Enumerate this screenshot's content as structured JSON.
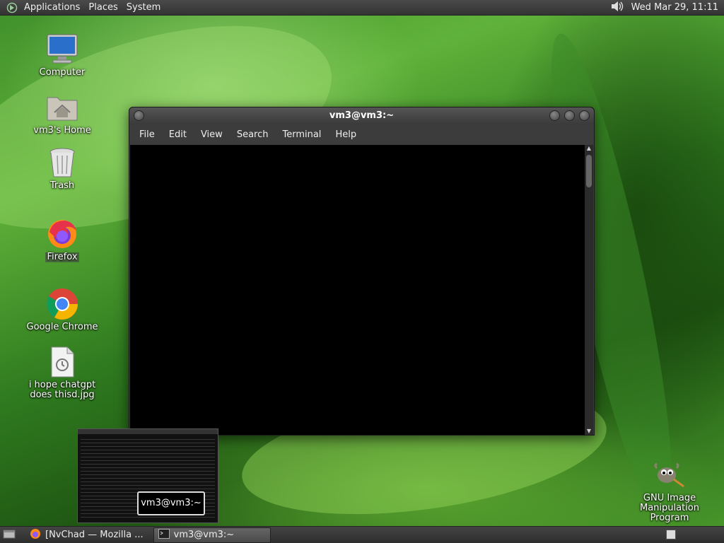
{
  "top_panel": {
    "menus": [
      "Applications",
      "Places",
      "System"
    ],
    "clock": "Wed Mar 29, 11:11"
  },
  "desktop": {
    "icons": [
      {
        "label": "Computer",
        "icon": "computer-icon"
      },
      {
        "label": "vm3's Home",
        "icon": "home-folder-icon"
      },
      {
        "label": "Trash",
        "icon": "trash-icon"
      },
      {
        "label": "Firefox",
        "icon": "firefox-icon"
      },
      {
        "label": "Google Chrome",
        "icon": "chrome-icon"
      },
      {
        "label": "i hope chatgpt does thisd.jpg",
        "icon": "image-file-icon"
      },
      {
        "label": "GNU Image Manipulation Program",
        "icon": "gimp-icon"
      }
    ]
  },
  "terminal": {
    "title": "vm3@vm3:~",
    "menu": [
      "File",
      "Edit",
      "View",
      "Search",
      "Terminal",
      "Help"
    ]
  },
  "preview": {
    "tooltip": "vm3@vm3:~"
  },
  "taskbar": {
    "tasks": [
      {
        "label": "[NvChad — Mozilla ...",
        "icon": "firefox-icon",
        "active": false
      },
      {
        "label": "vm3@vm3:~",
        "icon": "terminal-icon",
        "active": true
      }
    ]
  }
}
